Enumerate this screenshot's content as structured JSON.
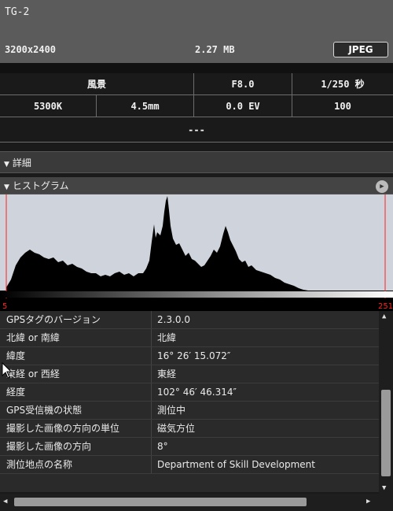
{
  "header": {
    "camera": "TG-2",
    "resolution": "3200x2400",
    "filesize": "2.27 MB",
    "format": "JPEG"
  },
  "summary": {
    "scene": "風景",
    "aperture": "F8.0",
    "shutter": "1/250 秒",
    "white_balance": "5300K",
    "focal_length": "4.5mm",
    "exposure_comp": "0.0 EV",
    "iso": "100",
    "extra": "---"
  },
  "details_header": "詳細",
  "histogram": {
    "title": "ヒストグラム",
    "min_label": "5",
    "max_label": "251"
  },
  "gps_rows": [
    {
      "key": "GPSタグのバージョン",
      "value": "2.3.0.0"
    },
    {
      "key": "北緯 or 南緯",
      "value": "北緯"
    },
    {
      "key": "緯度",
      "value": "16° 26′ 15.072″"
    },
    {
      "key": "東経 or 西経",
      "value": "東経"
    },
    {
      "key": "経度",
      "value": "102° 46′ 46.314″"
    },
    {
      "key": "GPS受信機の状態",
      "value": "測位中"
    },
    {
      "key": "撮影した画像の方向の単位",
      "value": "磁気方位"
    },
    {
      "key": "撮影した画像の方向",
      "value": "8°"
    },
    {
      "key": "測位地点の名称",
      "value": "Department of Skill Development"
    }
  ],
  "colors": {
    "header_bg": "#5b5b5b",
    "histogram_bg": "#cfd3dc",
    "histogram_fill": "#000000",
    "clip_line": "#ff2020"
  }
}
